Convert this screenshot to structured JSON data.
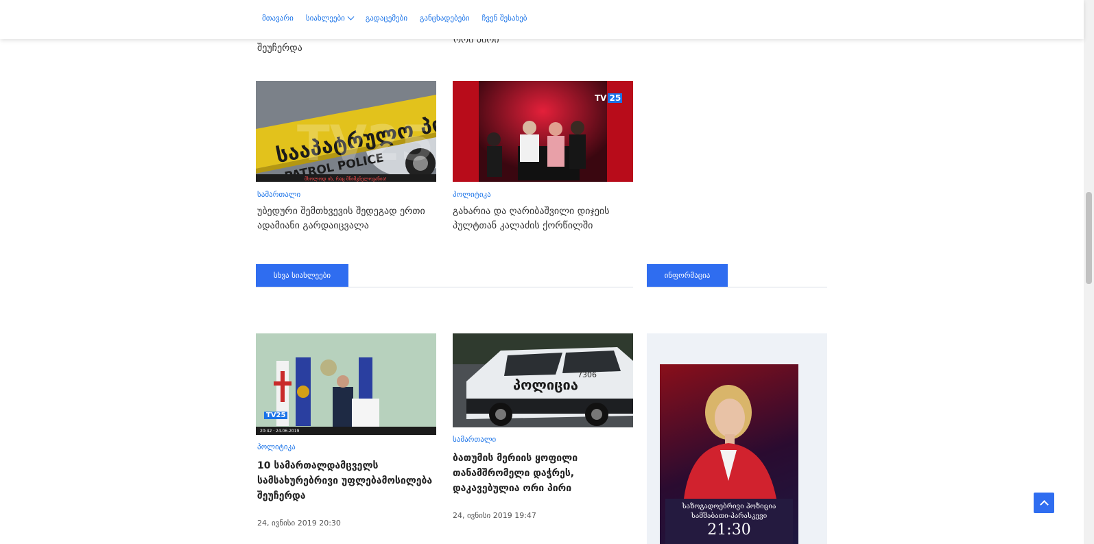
{
  "nav": {
    "items": [
      {
        "label": "მთავარი"
      },
      {
        "label": "სიახლეები"
      },
      {
        "label": "გადაცემები"
      },
      {
        "label": "განცხადებები"
      },
      {
        "label": "ჩვენ შესახებ"
      }
    ]
  },
  "top_cut": {
    "left_tail": "შეუჩერდა",
    "right_tail": "ორი პირი"
  },
  "featured": [
    {
      "category": "სამართალი",
      "title": "უბედური შემთხვევის შედეგად ერთი ადამიანი გარდაიცვალა",
      "thumb_caption": "მხოლოდ ის, რაც მნიშვნელოვანია!",
      "thumb_text": "სააპატრულო პოლიცია",
      "thumb_text_en": "PATROL POLICE"
    },
    {
      "category": "პოლიტიკა",
      "title": "გახარია და ღარიბაშვილი დიჯეის პულტთან კალაძის ქორწილში",
      "logo": "TV 25"
    }
  ],
  "sections": {
    "other_news": "სხვა სიახლეები",
    "info": "ინფორმაცია"
  },
  "other_news": [
    {
      "category": "პოლიტიკა",
      "title": "10 სამართალდამცველს სამსახურებრივი უფლებამოსილება შეუჩერდა",
      "date": "24, ივნისი 2019 20:30",
      "logo": "TV25"
    },
    {
      "category": "სამართალი",
      "title": "ბათუმის მერიის ყოფილი თანამშრომელი დაჭრეს, დაკავებულია ორი პირი",
      "date": "24, ივნისი 2019 19:47",
      "car_text": "პოლიცია",
      "car_number": "7306"
    }
  ],
  "promo": {
    "line1": "საზოგადოებრივი პოზიცია",
    "line2": "სამშაბათი-პარასკევი",
    "time": "21:30"
  },
  "colors": {
    "accent": "#2f6df0",
    "link": "#1a73e8"
  }
}
